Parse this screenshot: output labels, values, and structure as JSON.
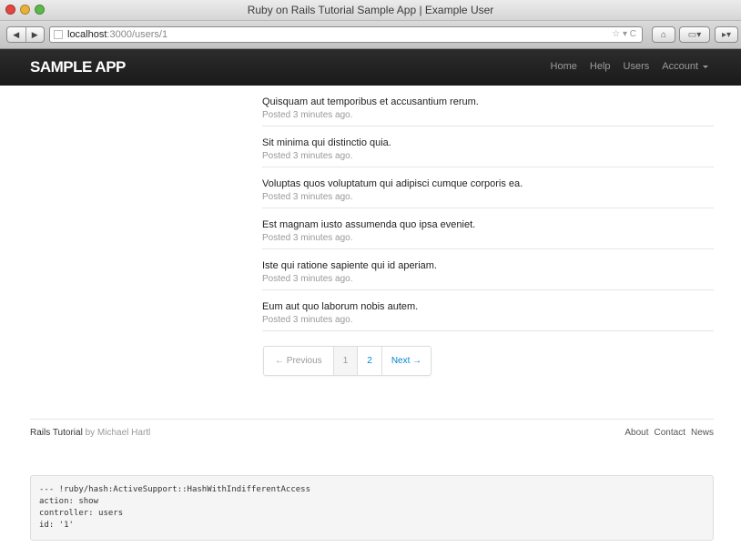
{
  "window": {
    "title": "Ruby on Rails Tutorial Sample App | Example User",
    "url_host": "localhost",
    "url_rest": ":3000/users/1"
  },
  "navbar": {
    "logo": "Sample App",
    "links": [
      "Home",
      "Help",
      "Users",
      "Account"
    ]
  },
  "microposts": [
    {
      "content": "Quisquam aut temporibus et accusantium rerum.",
      "timestamp": "Posted 3 minutes ago."
    },
    {
      "content": "Sit minima qui distinctio quia.",
      "timestamp": "Posted 3 minutes ago."
    },
    {
      "content": "Voluptas quos voluptatum qui adipisci cumque corporis ea.",
      "timestamp": "Posted 3 minutes ago."
    },
    {
      "content": "Est magnam iusto assumenda quo ipsa eveniet.",
      "timestamp": "Posted 3 minutes ago."
    },
    {
      "content": "Iste qui ratione sapiente qui id aperiam.",
      "timestamp": "Posted 3 minutes ago."
    },
    {
      "content": "Eum aut quo laborum nobis autem.",
      "timestamp": "Posted 3 minutes ago."
    }
  ],
  "pagination": {
    "previous": "← Previous",
    "pages": [
      "1",
      "2"
    ],
    "current": "1",
    "next": "Next →"
  },
  "footer": {
    "title": "Rails Tutorial",
    "by": "by Michael Hartl",
    "links": [
      "About",
      "Contact",
      "News"
    ]
  },
  "debug": {
    "lines": [
      "--- !ruby/hash:ActiveSupport::HashWithIndifferentAccess",
      "action: show",
      "controller: users",
      "id: '1'"
    ]
  }
}
